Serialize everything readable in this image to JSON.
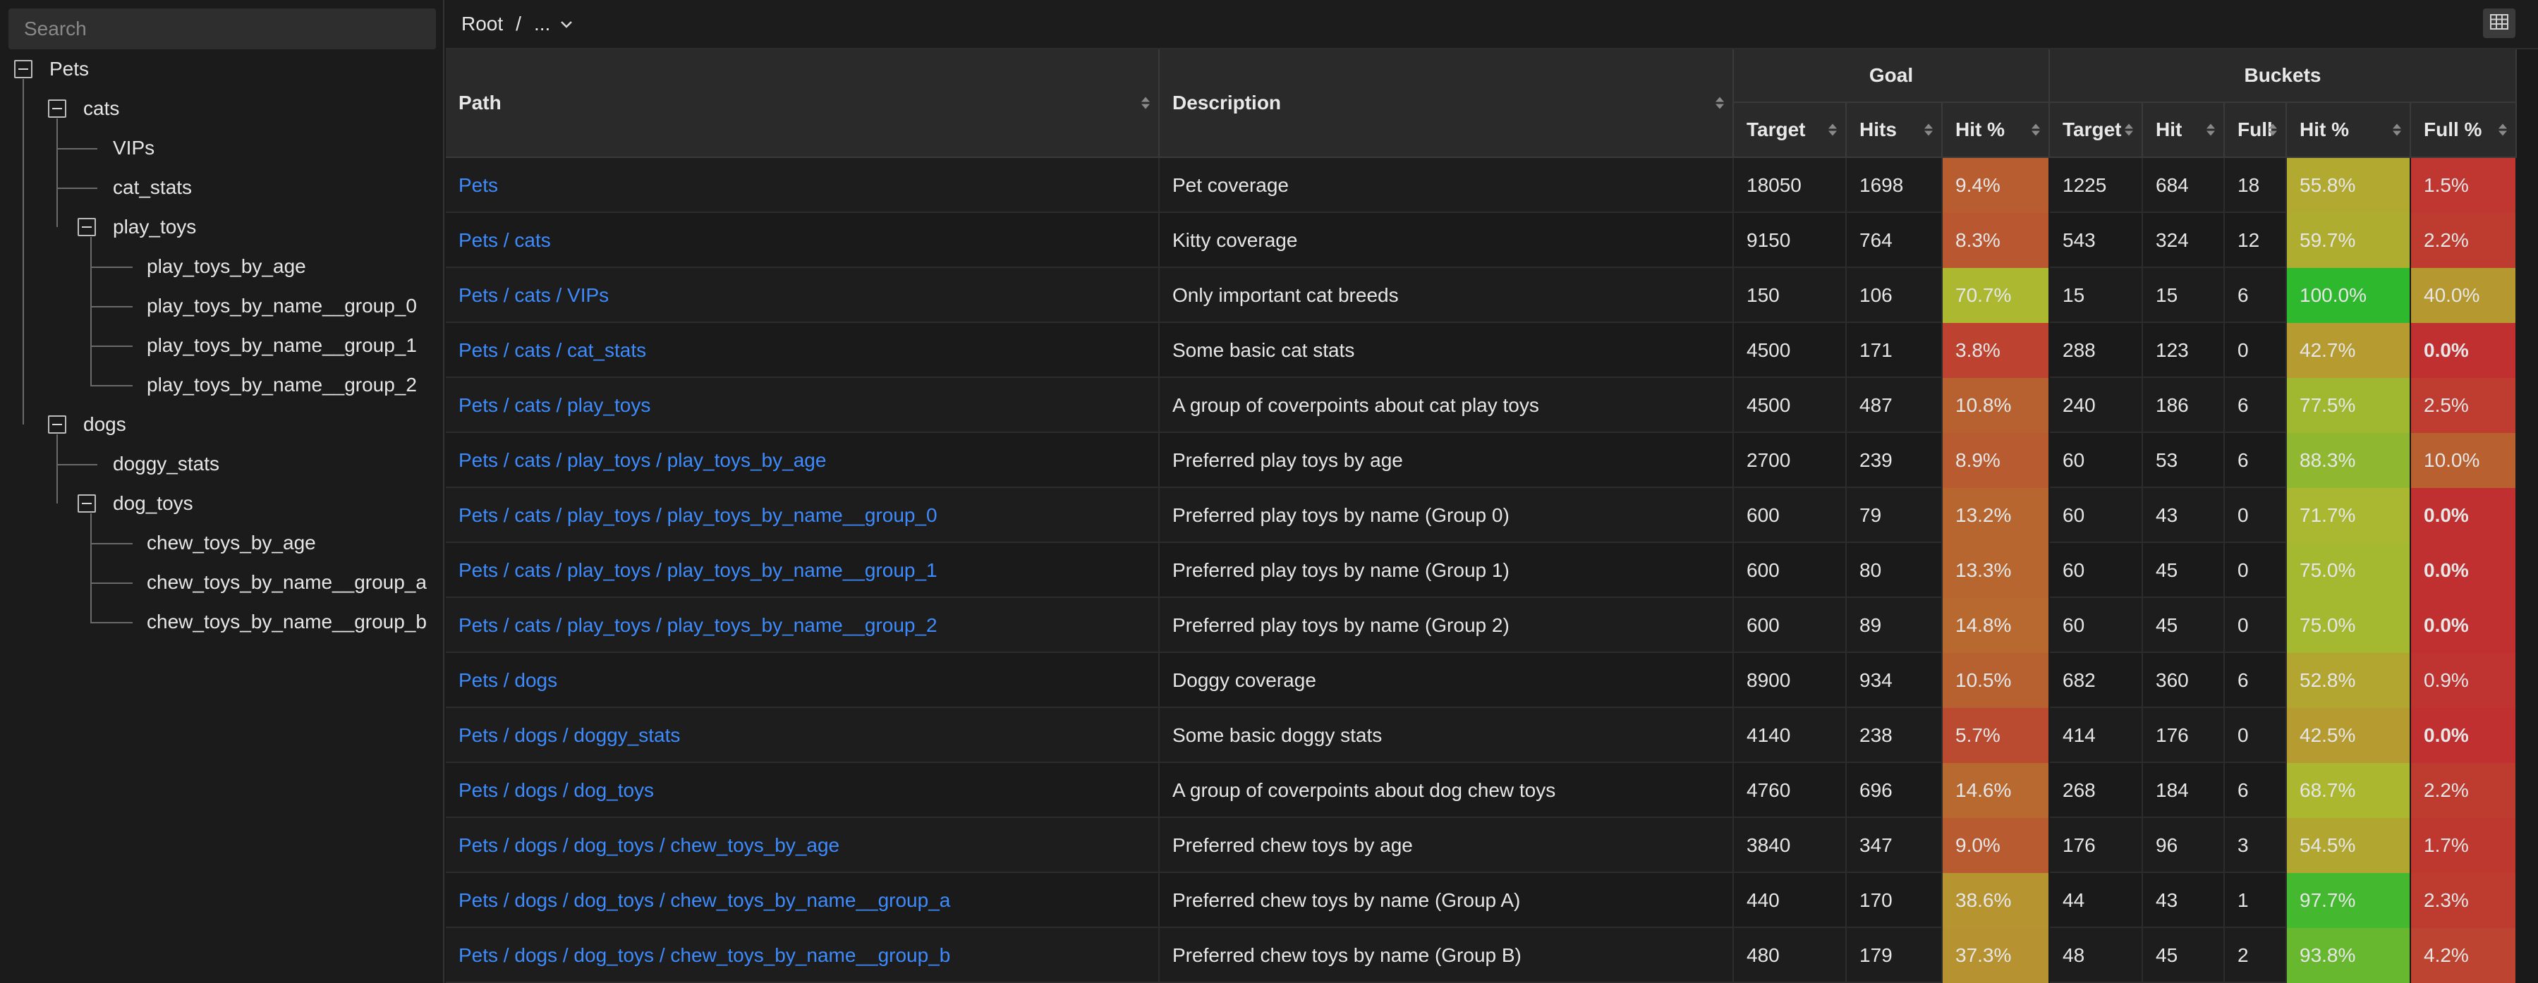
{
  "sidebar": {
    "search_placeholder": "Search",
    "tree": [
      {
        "label": "Pets",
        "level": 0,
        "toggle": true
      },
      {
        "label": "cats",
        "level": 1,
        "toggle": true
      },
      {
        "label": "VIPs",
        "level": 2,
        "toggle": false
      },
      {
        "label": "cat_stats",
        "level": 2,
        "toggle": false
      },
      {
        "label": "play_toys",
        "level": 2,
        "toggle": true
      },
      {
        "label": "play_toys_by_age",
        "level": 3,
        "toggle": false
      },
      {
        "label": "play_toys_by_name__group_0",
        "level": 3,
        "toggle": false
      },
      {
        "label": "play_toys_by_name__group_1",
        "level": 3,
        "toggle": false
      },
      {
        "label": "play_toys_by_name__group_2",
        "level": 3,
        "toggle": false
      },
      {
        "label": "dogs",
        "level": 1,
        "toggle": true
      },
      {
        "label": "doggy_stats",
        "level": 2,
        "toggle": false
      },
      {
        "label": "dog_toys",
        "level": 2,
        "toggle": true
      },
      {
        "label": "chew_toys_by_age",
        "level": 3,
        "toggle": false
      },
      {
        "label": "chew_toys_by_name__group_a",
        "level": 3,
        "toggle": false
      },
      {
        "label": "chew_toys_by_name__group_b",
        "level": 3,
        "toggle": false
      }
    ]
  },
  "breadcrumb": {
    "root": "Root",
    "separator": "/",
    "more": "..."
  },
  "table": {
    "group_headers": {
      "goal": "Goal",
      "buckets": "Buckets"
    },
    "headers": {
      "path": "Path",
      "description": "Description",
      "goal_target": "Target",
      "goal_hits": "Hits",
      "goal_hit_pct": "Hit %",
      "buckets_target": "Target",
      "buckets_hit": "Hit",
      "buckets_full": "Full",
      "buckets_hit_pct": "Hit %",
      "buckets_full_pct": "Full %"
    },
    "rows": [
      {
        "path": "Pets",
        "description": "Pet coverage",
        "goal_target": "18050",
        "goal_hits": "1698",
        "goal_hit_pct": "9.4%",
        "b_target": "1225",
        "b_hit": "684",
        "b_full": "18",
        "b_hit_pct": "55.8%",
        "b_full_pct": "1.5%"
      },
      {
        "path": "Pets / cats",
        "description": "Kitty coverage",
        "goal_target": "9150",
        "goal_hits": "764",
        "goal_hit_pct": "8.3%",
        "b_target": "543",
        "b_hit": "324",
        "b_full": "12",
        "b_hit_pct": "59.7%",
        "b_full_pct": "2.2%"
      },
      {
        "path": "Pets / cats / VIPs",
        "description": "Only important cat breeds",
        "goal_target": "150",
        "goal_hits": "106",
        "goal_hit_pct": "70.7%",
        "b_target": "15",
        "b_hit": "15",
        "b_full": "6",
        "b_hit_pct": "100.0%",
        "b_full_pct": "40.0%"
      },
      {
        "path": "Pets / cats / cat_stats",
        "description": "Some basic cat stats",
        "goal_target": "4500",
        "goal_hits": "171",
        "goal_hit_pct": "3.8%",
        "b_target": "288",
        "b_hit": "123",
        "b_full": "0",
        "b_hit_pct": "42.7%",
        "b_full_pct": "0.0%"
      },
      {
        "path": "Pets / cats / play_toys",
        "description": "A group of coverpoints about cat play toys",
        "goal_target": "4500",
        "goal_hits": "487",
        "goal_hit_pct": "10.8%",
        "b_target": "240",
        "b_hit": "186",
        "b_full": "6",
        "b_hit_pct": "77.5%",
        "b_full_pct": "2.5%"
      },
      {
        "path": "Pets / cats / play_toys / play_toys_by_age",
        "description": "Preferred play toys by age",
        "goal_target": "2700",
        "goal_hits": "239",
        "goal_hit_pct": "8.9%",
        "b_target": "60",
        "b_hit": "53",
        "b_full": "6",
        "b_hit_pct": "88.3%",
        "b_full_pct": "10.0%"
      },
      {
        "path": "Pets / cats / play_toys / play_toys_by_name__group_0",
        "description": "Preferred play toys by name (Group 0)",
        "goal_target": "600",
        "goal_hits": "79",
        "goal_hit_pct": "13.2%",
        "b_target": "60",
        "b_hit": "43",
        "b_full": "0",
        "b_hit_pct": "71.7%",
        "b_full_pct": "0.0%"
      },
      {
        "path": "Pets / cats / play_toys / play_toys_by_name__group_1",
        "description": "Preferred play toys by name (Group 1)",
        "goal_target": "600",
        "goal_hits": "80",
        "goal_hit_pct": "13.3%",
        "b_target": "60",
        "b_hit": "45",
        "b_full": "0",
        "b_hit_pct": "75.0%",
        "b_full_pct": "0.0%"
      },
      {
        "path": "Pets / cats / play_toys / play_toys_by_name__group_2",
        "description": "Preferred play toys by name (Group 2)",
        "goal_target": "600",
        "goal_hits": "89",
        "goal_hit_pct": "14.8%",
        "b_target": "60",
        "b_hit": "45",
        "b_full": "0",
        "b_hit_pct": "75.0%",
        "b_full_pct": "0.0%"
      },
      {
        "path": "Pets / dogs",
        "description": "Doggy coverage",
        "goal_target": "8900",
        "goal_hits": "934",
        "goal_hit_pct": "10.5%",
        "b_target": "682",
        "b_hit": "360",
        "b_full": "6",
        "b_hit_pct": "52.8%",
        "b_full_pct": "0.9%"
      },
      {
        "path": "Pets / dogs / doggy_stats",
        "description": "Some basic doggy stats",
        "goal_target": "4140",
        "goal_hits": "238",
        "goal_hit_pct": "5.7%",
        "b_target": "414",
        "b_hit": "176",
        "b_full": "0",
        "b_hit_pct": "42.5%",
        "b_full_pct": "0.0%"
      },
      {
        "path": "Pets / dogs / dog_toys",
        "description": "A group of coverpoints about dog chew toys",
        "goal_target": "4760",
        "goal_hits": "696",
        "goal_hit_pct": "14.6%",
        "b_target": "268",
        "b_hit": "184",
        "b_full": "6",
        "b_hit_pct": "68.7%",
        "b_full_pct": "2.2%"
      },
      {
        "path": "Pets / dogs / dog_toys / chew_toys_by_age",
        "description": "Preferred chew toys by age",
        "goal_target": "3840",
        "goal_hits": "347",
        "goal_hit_pct": "9.0%",
        "b_target": "176",
        "b_hit": "96",
        "b_full": "3",
        "b_hit_pct": "54.5%",
        "b_full_pct": "1.7%"
      },
      {
        "path": "Pets / dogs / dog_toys / chew_toys_by_name__group_a",
        "description": "Preferred chew toys by name (Group A)",
        "goal_target": "440",
        "goal_hits": "170",
        "goal_hit_pct": "38.6%",
        "b_target": "44",
        "b_hit": "43",
        "b_full": "1",
        "b_hit_pct": "97.7%",
        "b_full_pct": "2.3%"
      },
      {
        "path": "Pets / dogs / dog_toys / chew_toys_by_name__group_b",
        "description": "Preferred chew toys by name (Group B)",
        "goal_target": "480",
        "goal_hits": "179",
        "goal_hit_pct": "37.3%",
        "b_target": "48",
        "b_hit": "45",
        "b_full": "2",
        "b_hit_pct": "93.8%",
        "b_full_pct": "4.2%"
      }
    ]
  }
}
